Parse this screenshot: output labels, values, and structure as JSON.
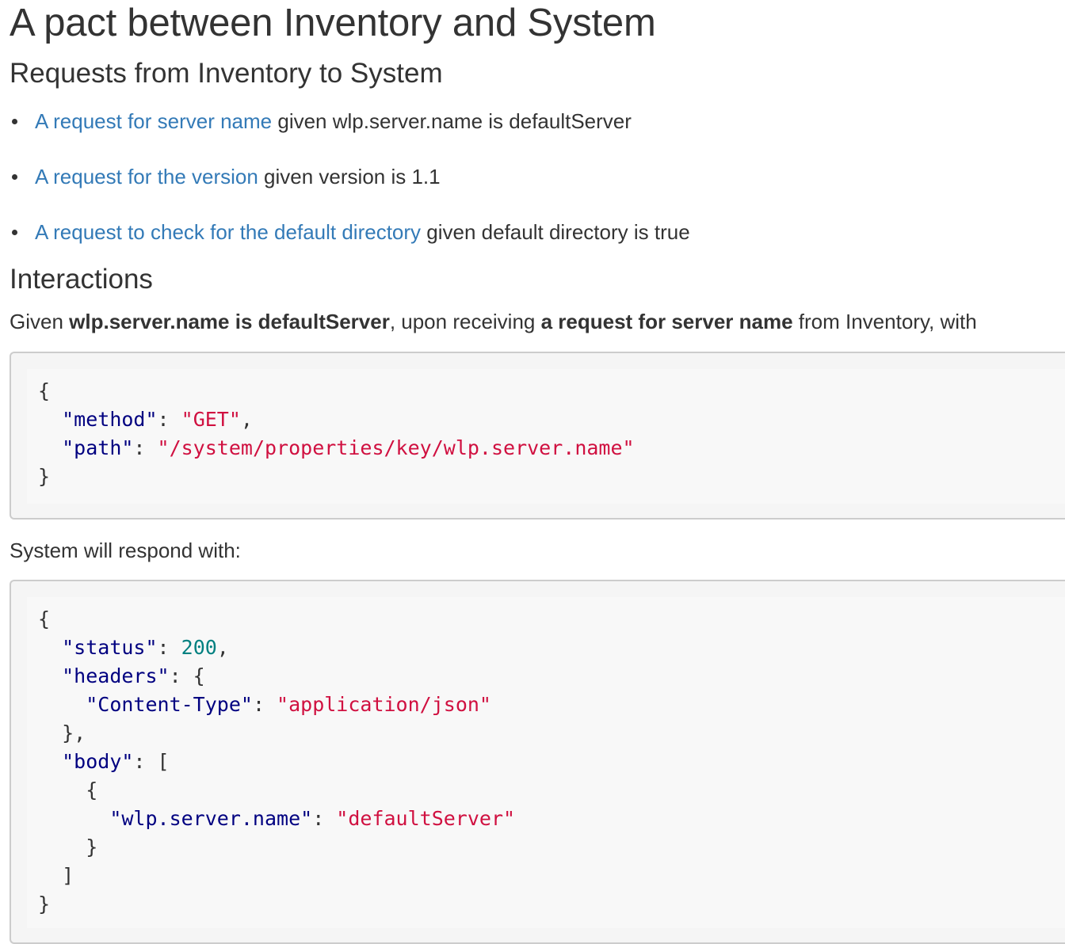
{
  "title": "A pact between Inventory and System",
  "requests_heading": "Requests from Inventory to System",
  "requests": [
    {
      "link": "A request for server name",
      "condition": " given wlp.server.name is defaultServer"
    },
    {
      "link": "A request for the version",
      "condition": " given version is 1.1"
    },
    {
      "link": "A request to check for the default directory",
      "condition": " given default directory is true"
    }
  ],
  "interactions_heading": "Interactions",
  "interaction": {
    "given_word": "Given ",
    "state": "wlp.server.name is defaultServer",
    "upon": ", upon receiving ",
    "description": "a request for server name",
    "from": " from Inventory, with",
    "respond_text": "System will respond with:"
  },
  "request_json": {
    "method_key": "\"method\"",
    "method_value": "\"GET\"",
    "path_key": "\"path\"",
    "path_value": "\"/system/properties/key/wlp.server.name\""
  },
  "response_json": {
    "status_key": "\"status\"",
    "status_value": "200",
    "headers_key": "\"headers\"",
    "content_type_key": "\"Content-Type\"",
    "content_type_value": "\"application/json\"",
    "body_key": "\"body\"",
    "server_name_key": "\"wlp.server.name\"",
    "server_name_value": "\"defaultServer\""
  }
}
